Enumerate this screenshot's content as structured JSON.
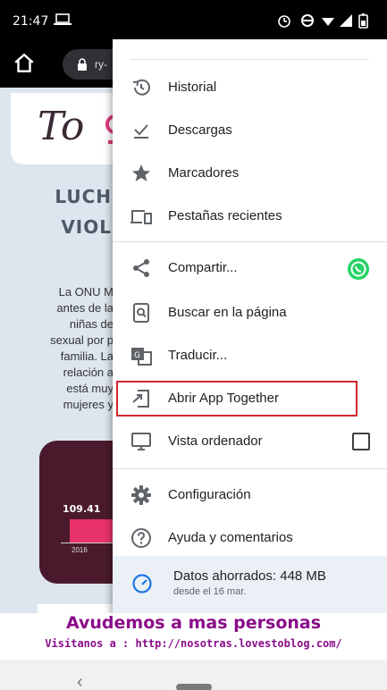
{
  "status_bar": {
    "time": "21:47"
  },
  "toolbar": {
    "url_fragment": "ry-"
  },
  "page": {
    "logo_text": "To",
    "heading_lines": [
      "LUCH",
      "VIOL"
    ],
    "body_lines": [
      "La ONU M",
      "antes de la",
      "niñas de",
      "sexual por p",
      "familia. La",
      "relación a",
      "está muy",
      "mujeres y"
    ],
    "chart_value": "109.41",
    "chart_year": "2016"
  },
  "menu": {
    "items": [
      {
        "label": "Historial",
        "icon": "history-icon"
      },
      {
        "label": "Descargas",
        "icon": "download-icon"
      },
      {
        "label": "Marcadores",
        "icon": "star-icon"
      },
      {
        "label": "Pestañas recientes",
        "icon": "recent-tabs-icon"
      },
      {
        "label": "Compartir...",
        "icon": "share-icon",
        "extra_icon": "whatsapp-icon"
      },
      {
        "label": "Buscar en la página",
        "icon": "find-in-page-icon"
      },
      {
        "label": "Traducir...",
        "icon": "translate-icon"
      },
      {
        "label": "Abrir App Together",
        "icon": "open-app-icon",
        "highlighted": true
      },
      {
        "label": "Vista ordenador",
        "icon": "desktop-icon",
        "checked": false
      },
      {
        "label": "Configuración",
        "icon": "gear-icon"
      },
      {
        "label": "Ayuda y comentarios",
        "icon": "help-icon"
      }
    ],
    "data_saved": {
      "title": "Datos ahorrados: 448 MB",
      "subtitle": "desde el 16 mar."
    }
  },
  "footer": {
    "title": "Avudemos a mas personas",
    "subtitle": "Visítanos a : http://nosotras.lovestoblog.com/"
  },
  "colors": {
    "highlight": "#d0282e",
    "footer_text": "#8a0c8a",
    "whatsapp": "#25d366"
  }
}
